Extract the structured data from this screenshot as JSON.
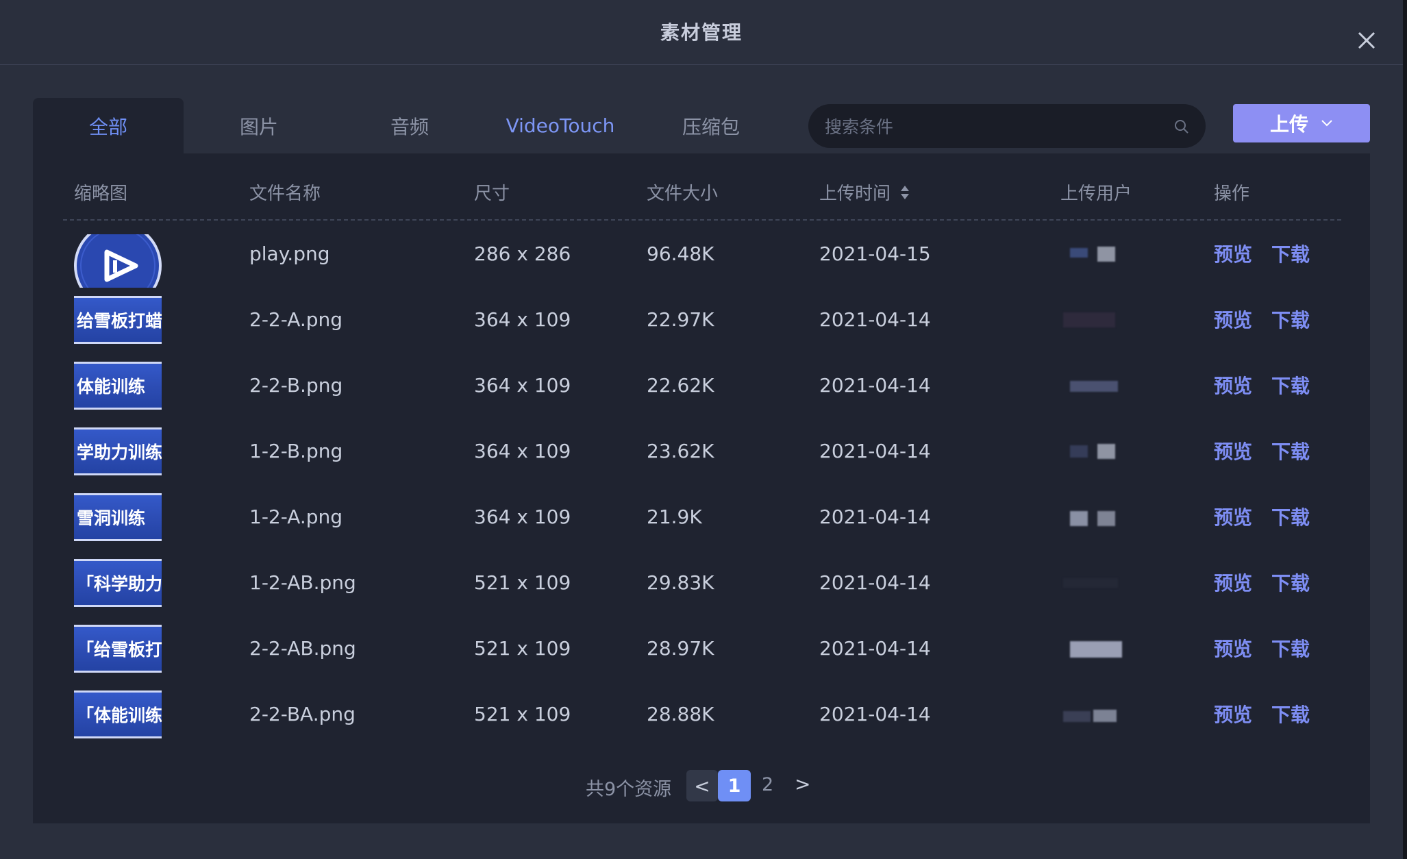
{
  "dialog": {
    "title": "素材管理"
  },
  "tabs": [
    {
      "label": "全部",
      "active": true
    },
    {
      "label": "图片",
      "active": false
    },
    {
      "label": "音频",
      "active": false
    },
    {
      "label": "VideoTouch",
      "active": false
    },
    {
      "label": "压缩包",
      "active": false
    }
  ],
  "search": {
    "placeholder": "搜索条件",
    "value": ""
  },
  "upload": {
    "label": "上传",
    "icon": "chevron-down-icon"
  },
  "table": {
    "headers": {
      "thumbnail": "缩略图",
      "filename": "文件名称",
      "dimensions": "尺寸",
      "filesize": "文件大小",
      "upload_time": "上传时间",
      "uploader": "上传用户",
      "actions": "操作"
    },
    "rows": [
      {
        "thumb_text": "",
        "filename": "play.png",
        "dimensions": "286 x 286",
        "filesize": "96.48K",
        "upload_time": "2021-04-15",
        "preview": "预览",
        "download": "下载"
      },
      {
        "thumb_text": "给雪板打蜡",
        "filename": "2-2-A.png",
        "dimensions": "364 x 109",
        "filesize": "22.97K",
        "upload_time": "2021-04-14",
        "preview": "预览",
        "download": "下载"
      },
      {
        "thumb_text": " 体能训练",
        "filename": "2-2-B.png",
        "dimensions": "364 x 109",
        "filesize": "22.62K",
        "upload_time": "2021-04-14",
        "preview": "预览",
        "download": "下载"
      },
      {
        "thumb_text": "学助力训练",
        "filename": "1-2-B.png",
        "dimensions": "364 x 109",
        "filesize": "23.62K",
        "upload_time": "2021-04-14",
        "preview": "预览",
        "download": "下载"
      },
      {
        "thumb_text": " 雪洞训练",
        "filename": "1-2-A.png",
        "dimensions": "364 x 109",
        "filesize": "21.9K",
        "upload_time": "2021-04-14",
        "preview": "预览",
        "download": "下载"
      },
      {
        "thumb_text": "「科学助力",
        "filename": "1-2-AB.png",
        "dimensions": "521 x 109",
        "filesize": "29.83K",
        "upload_time": "2021-04-14",
        "preview": "预览",
        "download": "下载"
      },
      {
        "thumb_text": "「给雪板打",
        "filename": "2-2-AB.png",
        "dimensions": "521 x 109",
        "filesize": "28.97K",
        "upload_time": "2021-04-14",
        "preview": "预览",
        "download": "下载"
      },
      {
        "thumb_text": "「体能训练",
        "filename": "2-2-BA.png",
        "dimensions": "521 x 109",
        "filesize": "28.88K",
        "upload_time": "2021-04-14",
        "preview": "预览",
        "download": "下载"
      }
    ]
  },
  "pagination": {
    "total": "共9个资源",
    "prev": "<",
    "pages": [
      "1",
      "2"
    ],
    "current": "1",
    "next": ">"
  },
  "colors": {
    "accent": "#6f8ff5",
    "upload_button": "#8d8ff3",
    "panel": "#1f2330",
    "background": "#2a2f3d"
  }
}
